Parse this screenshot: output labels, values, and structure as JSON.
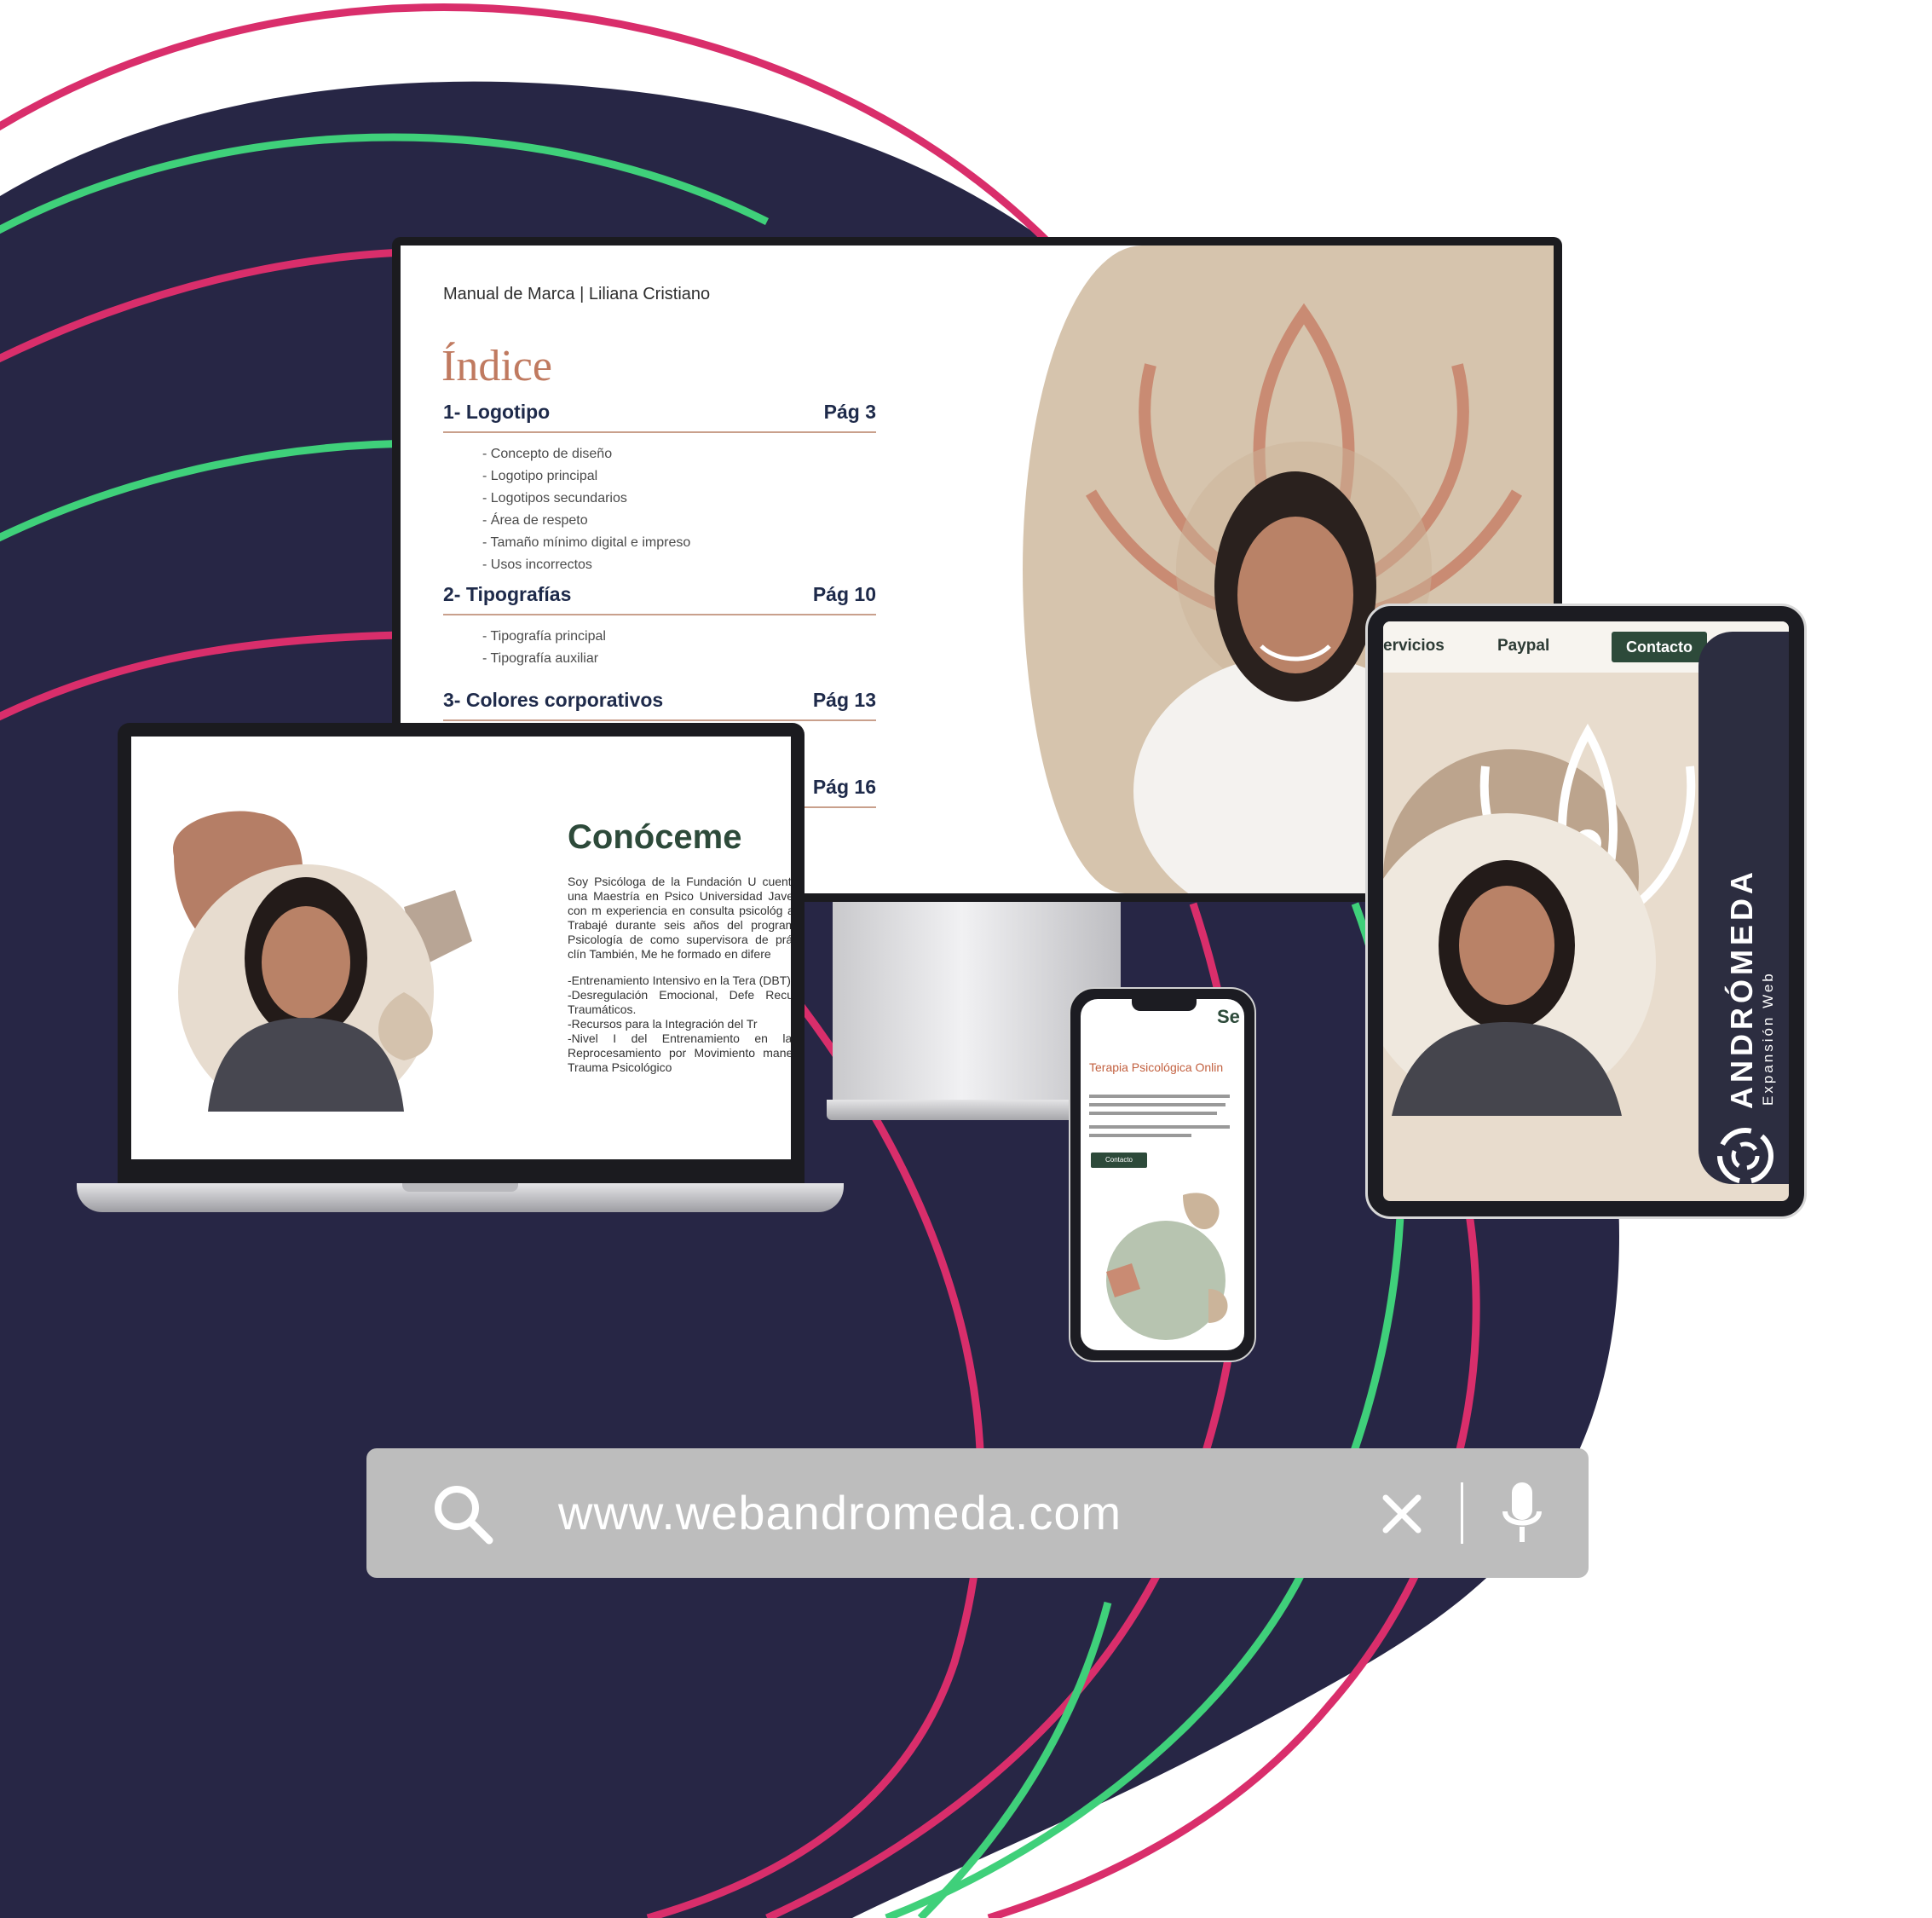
{
  "monitor": {
    "header": "Manual de Marca | Liliana Cristiano",
    "index_title": "Índice",
    "sections": [
      {
        "title": "1- Logotipo",
        "page": "Pág 3",
        "items": [
          "- Concepto de diseño",
          "- Logotipo principal",
          "- Logotipos secundarios",
          "- Área de respeto",
          "- Tamaño mínimo digital e impreso",
          "- Usos incorrectos"
        ]
      },
      {
        "title": "2- Tipografías",
        "page": "Pág 10",
        "items": [
          "- Tipografía principal",
          "- Tipografía auxiliar"
        ]
      },
      {
        "title": "3- Colores corporativos",
        "page": "Pág 13",
        "items": []
      },
      {
        "title": "",
        "page": "Pág 16",
        "items": []
      }
    ]
  },
  "laptop": {
    "title": "Conóceme",
    "paragraph": "Soy Psicóloga de la Fundación U cuento con una Maestría en Psico Universidad Javeriana, con m experiencia en consulta psicológ adulta. Trabajé durante seis años del programa de Psicología de como supervisora de prácticas clín También, Me he formado en difere",
    "list": [
      "-Entrenamiento Intensivo en la Tera (DBT)",
      "-Desregulación Emocional, Defe Recuerdos Traumáticos.",
      "-Recursos para la Integración del Tr",
      "-Nivel I del Entrenamiento en la Ter Reprocesamiento por Movimiento manejo de Trauma Psicológico"
    ]
  },
  "tablet": {
    "nav": {
      "services": "ervicios",
      "paypal": "Paypal",
      "contact": "Contacto"
    },
    "brand": "ANDRÓMEDA",
    "brand_sub": "Expansión Web"
  },
  "phone": {
    "header": "Se",
    "title": "Terapia Psicológica Onlin",
    "button": "Contacto"
  },
  "search": {
    "url": "www.webandromeda.com",
    "icons": [
      "search-icon",
      "clear-icon",
      "microphone-icon"
    ]
  },
  "colors": {
    "navy": "#272645",
    "pink": "#d92e6b",
    "green": "#3fd07a",
    "beige": "#d6c4ad",
    "terracotta": "#c07a60",
    "forest": "#2d4a3a"
  }
}
